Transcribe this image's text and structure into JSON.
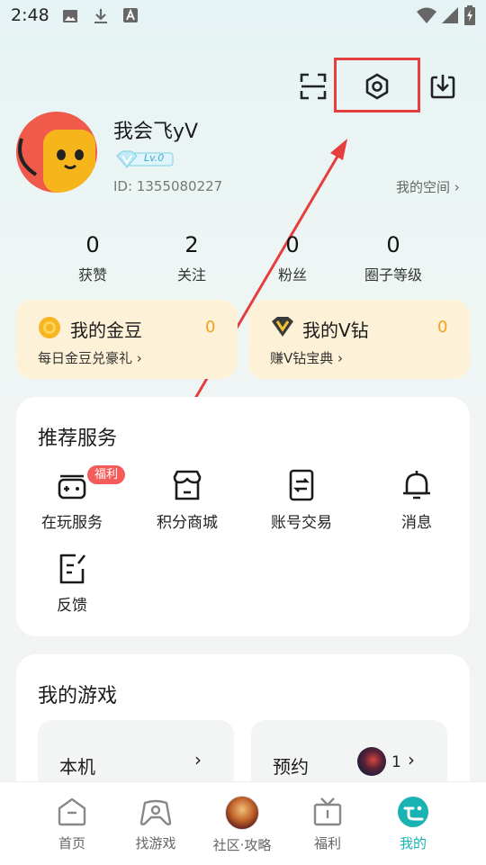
{
  "status_bar": {
    "time": "2:48"
  },
  "profile": {
    "name": "我会飞yV",
    "level": "Lv.0",
    "id_text": "ID: 1355080227",
    "space_link": "我的空间 ›"
  },
  "stats": [
    {
      "value": "0",
      "label": "获赞"
    },
    {
      "value": "2",
      "label": "关注"
    },
    {
      "value": "0",
      "label": "粉丝"
    },
    {
      "value": "0",
      "label": "圈子等级"
    }
  ],
  "cards": {
    "gold": {
      "title": "我的金豆",
      "value": "0",
      "sub": "每日金豆兑豪礼 ›"
    },
    "diamond": {
      "title": "我的V钻",
      "value": "0",
      "sub": "赚V钻宝典 ›"
    }
  },
  "services": {
    "title": "推荐服务",
    "badge": "福利",
    "items": [
      {
        "label": "在玩服务",
        "icon": "gamepad-icon"
      },
      {
        "label": "积分商城",
        "icon": "store-icon"
      },
      {
        "label": "账号交易",
        "icon": "exchange-icon"
      },
      {
        "label": "消息",
        "icon": "bell-icon"
      },
      {
        "label": "反馈",
        "icon": "feedback-icon"
      }
    ]
  },
  "games": {
    "title": "我的游戏",
    "local": {
      "label": "本机",
      "arrow": "›"
    },
    "reserve": {
      "label": "预约",
      "count": "1",
      "arrow": "›"
    }
  },
  "bottom_nav": [
    {
      "label": "首页",
      "icon": "home-icon"
    },
    {
      "label": "找游戏",
      "icon": "controller-icon"
    },
    {
      "label": "社区·攻略",
      "icon": "community-avatar-icon"
    },
    {
      "label": "福利",
      "icon": "gift-icon"
    },
    {
      "label": "我的",
      "icon": "mine-icon",
      "active": true
    }
  ],
  "colors": {
    "accent": "#19b3b3",
    "gold": "#f2a21a",
    "highlight": "#e53e3e",
    "badge": "#f45b5b"
  }
}
